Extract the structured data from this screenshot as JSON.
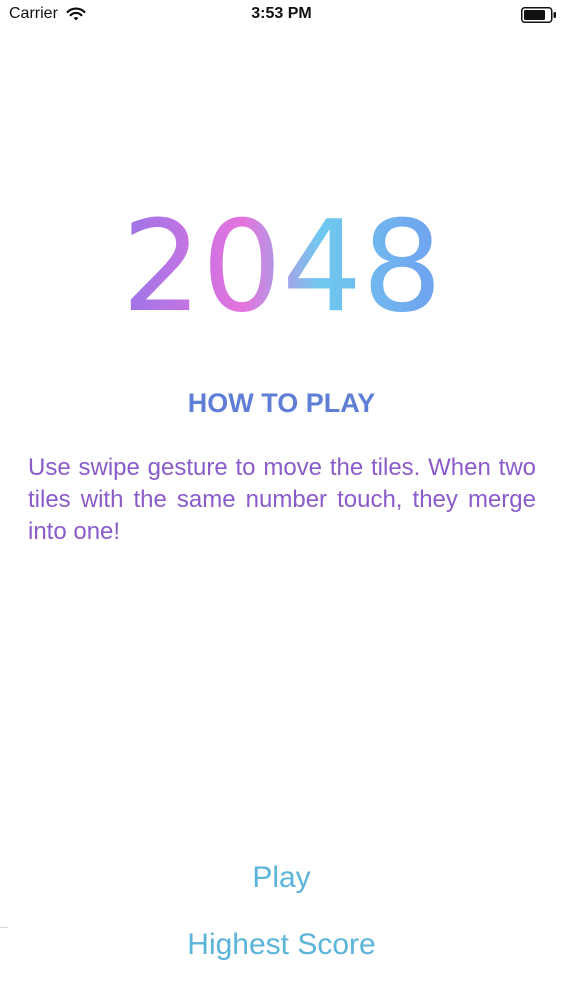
{
  "status_bar": {
    "carrier": "Carrier",
    "time": "3:53 PM"
  },
  "logo": {
    "text": "2048",
    "colors": [
      "#9b74e8",
      "#e573de",
      "#6fc9ef",
      "#70a0ef"
    ]
  },
  "how_to_play": {
    "title": "HOW TO PLAY",
    "description": "Use swipe gesture to move the tiles. When two tiles with the same number touch, they merge into one!"
  },
  "menu": {
    "play_label": "Play",
    "highest_score_label": "Highest Score"
  },
  "colors": {
    "title": "#5f7fd6",
    "description": "#8a5cc9",
    "buttons": "#5bb4da"
  }
}
